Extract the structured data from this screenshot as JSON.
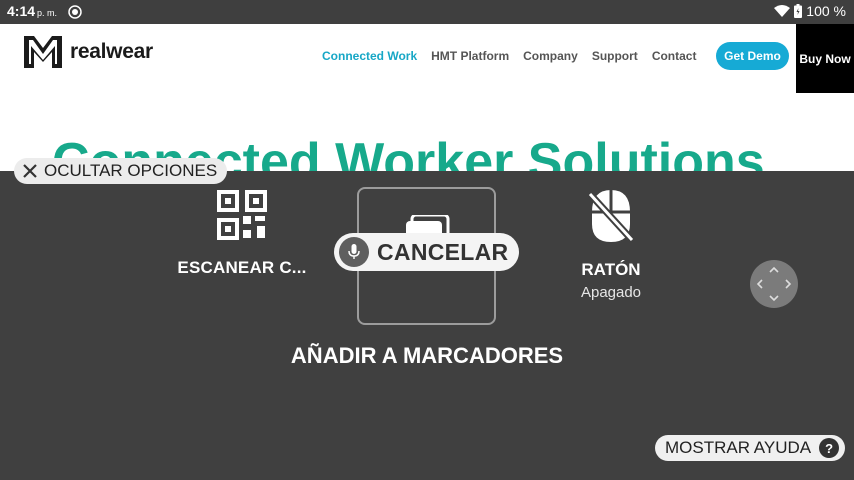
{
  "status_bar": {
    "time": "4:14",
    "ampm": "p. m.",
    "battery_text": "100 %"
  },
  "website": {
    "brand": "realwear",
    "nav": [
      "Connected Work",
      "HMT Platform",
      "Company",
      "Support",
      "Contact"
    ],
    "get_demo": "Get Demo",
    "buy_now": "Buy Now",
    "hero_title": "Connected Worker Solutions",
    "colors": {
      "accent": "#17a7c6",
      "hero": "#17a98b"
    }
  },
  "overlay": {
    "hide_options": "OCULTAR OPCIONES",
    "scan_label": "ESCANEAR C...",
    "cancel_label": "CANCELAR",
    "bookmark_label": "AÑADIR A MARCADORES",
    "mouse_label": "RATÓN",
    "mouse_status": "Apagado",
    "show_help": "MOSTRAR AYUDA",
    "help_icon_text": "?"
  }
}
